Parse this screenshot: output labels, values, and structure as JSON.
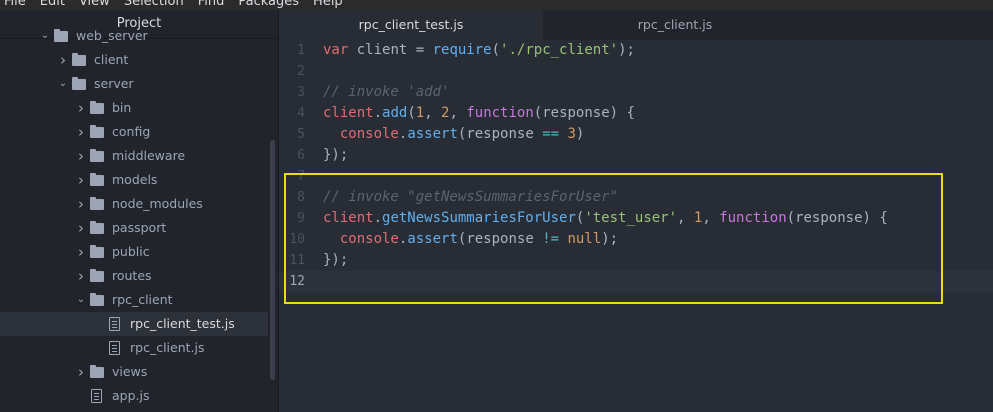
{
  "menu": [
    "File",
    "Edit",
    "View",
    "Selection",
    "Find",
    "Packages",
    "Help"
  ],
  "sidebar": {
    "title": "Project",
    "items": [
      {
        "label": "web_server",
        "kind": "folder",
        "open": true,
        "depth": 1
      },
      {
        "label": "client",
        "kind": "folder",
        "open": false,
        "depth": 2
      },
      {
        "label": "server",
        "kind": "folder",
        "open": true,
        "depth": 2
      },
      {
        "label": "bin",
        "kind": "folder",
        "open": false,
        "depth": 3
      },
      {
        "label": "config",
        "kind": "folder",
        "open": false,
        "depth": 3
      },
      {
        "label": "middleware",
        "kind": "folder",
        "open": false,
        "depth": 3
      },
      {
        "label": "models",
        "kind": "folder",
        "open": false,
        "depth": 3
      },
      {
        "label": "node_modules",
        "kind": "folder",
        "open": false,
        "depth": 3
      },
      {
        "label": "passport",
        "kind": "folder",
        "open": false,
        "depth": 3
      },
      {
        "label": "public",
        "kind": "folder",
        "open": false,
        "depth": 3
      },
      {
        "label": "routes",
        "kind": "folder",
        "open": false,
        "depth": 3
      },
      {
        "label": "rpc_client",
        "kind": "folder",
        "open": true,
        "depth": 3
      },
      {
        "label": "rpc_client_test.js",
        "kind": "file",
        "depth": 4,
        "selected": true
      },
      {
        "label": "rpc_client.js",
        "kind": "file",
        "depth": 4
      },
      {
        "label": "views",
        "kind": "folder",
        "open": false,
        "depth": 3
      },
      {
        "label": "app.js",
        "kind": "file",
        "depth": 3
      }
    ]
  },
  "tabs": [
    {
      "label": "rpc_client_test.js",
      "active": true
    },
    {
      "label": "rpc_client.js",
      "active": false
    }
  ],
  "editor": {
    "current_line": 12,
    "lines": [
      [
        [
          "v",
          "var"
        ],
        [
          "p",
          " client = "
        ],
        [
          "f",
          "require"
        ],
        [
          "p",
          "("
        ],
        [
          "s",
          "'./rpc_client'"
        ],
        [
          "p",
          ");"
        ]
      ],
      [],
      [
        [
          "c",
          "// invoke 'add'"
        ]
      ],
      [
        [
          "v",
          "client"
        ],
        [
          "p",
          "."
        ],
        [
          "f",
          "add"
        ],
        [
          "p",
          "("
        ],
        [
          "n",
          "1"
        ],
        [
          "p",
          ", "
        ],
        [
          "n",
          "2"
        ],
        [
          "p",
          ", "
        ],
        [
          "k",
          "function"
        ],
        [
          "p",
          "(response) {"
        ]
      ],
      [
        [
          "p",
          "  "
        ],
        [
          "v",
          "console"
        ],
        [
          "p",
          "."
        ],
        [
          "f",
          "assert"
        ],
        [
          "p",
          "(response "
        ],
        [
          "o",
          "=="
        ],
        [
          "p",
          " "
        ],
        [
          "n",
          "3"
        ],
        [
          "p",
          ")"
        ]
      ],
      [
        [
          "p",
          "});"
        ]
      ],
      [],
      [
        [
          "c",
          "// invoke \"getNewsSummariesForUser\""
        ]
      ],
      [
        [
          "v",
          "client"
        ],
        [
          "p",
          "."
        ],
        [
          "f",
          "getNewsSummariesForUser"
        ],
        [
          "p",
          "("
        ],
        [
          "s",
          "'test_user'"
        ],
        [
          "p",
          ", "
        ],
        [
          "n",
          "1"
        ],
        [
          "p",
          ", "
        ],
        [
          "k",
          "function"
        ],
        [
          "p",
          "(response) {"
        ]
      ],
      [
        [
          "p",
          "  "
        ],
        [
          "v",
          "console"
        ],
        [
          "p",
          "."
        ],
        [
          "f",
          "assert"
        ],
        [
          "p",
          "(response "
        ],
        [
          "o",
          "!="
        ],
        [
          "p",
          " "
        ],
        [
          "n",
          "null"
        ],
        [
          "p",
          ");"
        ]
      ],
      [
        [
          "p",
          "});"
        ]
      ],
      []
    ]
  },
  "colors": {
    "highlight_box": "#e8e000",
    "editor_bg": "#282c34",
    "sidebar_bg": "#21252b"
  }
}
